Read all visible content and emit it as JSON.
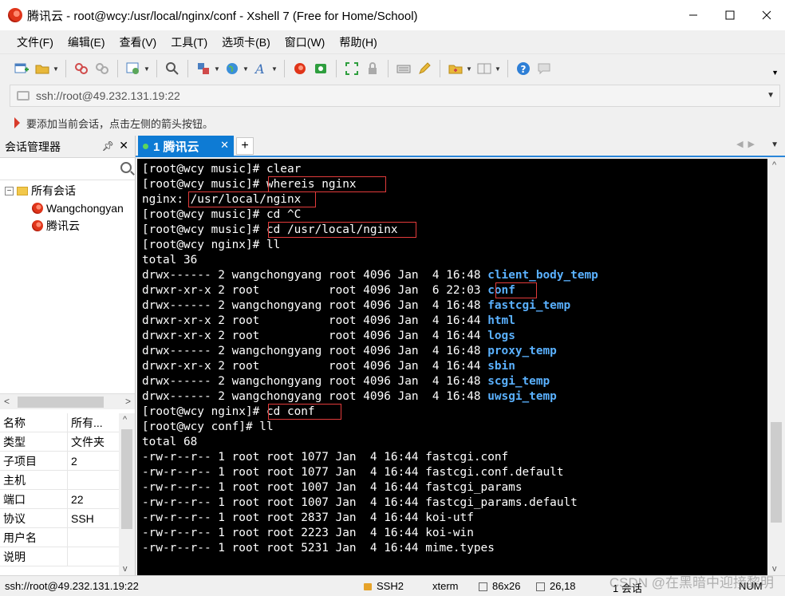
{
  "window": {
    "title": "腾讯云 - root@wcy:/usr/local/nginx/conf - Xshell 7 (Free for Home/School)"
  },
  "menu": [
    "文件(F)",
    "编辑(E)",
    "查看(V)",
    "工具(T)",
    "选项卡(B)",
    "窗口(W)",
    "帮助(H)"
  ],
  "address": {
    "value": "ssh://root@49.232.131.19:22"
  },
  "hint": "要添加当前会话，点击左侧的箭头按钮。",
  "session_manager": {
    "title": "会话管理器",
    "tree": {
      "root": "所有会话",
      "items": [
        "Wangchongyan",
        "腾讯云"
      ]
    },
    "properties": [
      {
        "key": "名称",
        "value": "所有..."
      },
      {
        "key": "类型",
        "value": "文件夹"
      },
      {
        "key": "子项目",
        "value": "2"
      },
      {
        "key": "主机",
        "value": ""
      },
      {
        "key": "端口",
        "value": "22"
      },
      {
        "key": "协议",
        "value": "SSH"
      },
      {
        "key": "用户名",
        "value": ""
      },
      {
        "key": "说明",
        "value": ""
      }
    ]
  },
  "tab": {
    "label": "1 腾讯云",
    "add": "+"
  },
  "terminal": {
    "lines": [
      {
        "text": "[root@wcy music]# clear"
      },
      {
        "text": "[root@wcy music]# whereis nginx"
      },
      {
        "text": "nginx: /usr/local/nginx"
      },
      {
        "text": "[root@wcy music]# cd ^C"
      },
      {
        "text": "[root@wcy music]# cd /usr/local/nginx"
      },
      {
        "text": "[root@wcy nginx]# ll"
      },
      {
        "text": "total 36"
      },
      {
        "text": "drwx------ 2 wangchongyang root 4096 Jan  4 16:48 ",
        "dir": "client_body_temp"
      },
      {
        "text": "drwxr-xr-x 2 root          root 4096 Jan  6 22:03 ",
        "dir": "conf"
      },
      {
        "text": "drwx------ 2 wangchongyang root 4096 Jan  4 16:48 ",
        "dir": "fastcgi_temp"
      },
      {
        "text": "drwxr-xr-x 2 root          root 4096 Jan  4 16:44 ",
        "dir": "html"
      },
      {
        "text": "drwxr-xr-x 2 root          root 4096 Jan  4 16:44 ",
        "dir": "logs"
      },
      {
        "text": "drwx------ 2 wangchongyang root 4096 Jan  4 16:48 ",
        "dir": "proxy_temp"
      },
      {
        "text": "drwxr-xr-x 2 root          root 4096 Jan  4 16:44 ",
        "dir": "sbin"
      },
      {
        "text": "drwx------ 2 wangchongyang root 4096 Jan  4 16:48 ",
        "dir": "scgi_temp"
      },
      {
        "text": "drwx------ 2 wangchongyang root 4096 Jan  4 16:48 ",
        "dir": "uwsgi_temp"
      },
      {
        "text": "[root@wcy nginx]# cd conf"
      },
      {
        "text": "[root@wcy conf]# ll"
      },
      {
        "text": "total 68"
      },
      {
        "text": "-rw-r--r-- 1 root root 1077 Jan  4 16:44 fastcgi.conf"
      },
      {
        "text": "-rw-r--r-- 1 root root 1077 Jan  4 16:44 fastcgi.conf.default"
      },
      {
        "text": "-rw-r--r-- 1 root root 1007 Jan  4 16:44 fastcgi_params"
      },
      {
        "text": "-rw-r--r-- 1 root root 1007 Jan  4 16:44 fastcgi_params.default"
      },
      {
        "text": "-rw-r--r-- 1 root root 2837 Jan  4 16:44 koi-utf"
      },
      {
        "text": "-rw-r--r-- 1 root root 2223 Jan  4 16:44 koi-win"
      },
      {
        "text": "-rw-r--r-- 1 root root 5231 Jan  4 16:44 mime.types"
      }
    ]
  },
  "status": {
    "connection": "ssh://root@49.232.131.19:22",
    "protocol": "SSH2",
    "term": "xterm",
    "size": "86x26",
    "cursor": "26,18",
    "sessions": "1 会话",
    "numlock": "NUM"
  },
  "watermark": "CSDN @在黑暗中迎接黎明",
  "colors": {
    "terminal_bg": "#000000",
    "terminal_fg": "#ffffff",
    "directory": "#5ab1ff",
    "highlight_box": "#e23b3b",
    "tab_active": "#0e7bd4"
  }
}
